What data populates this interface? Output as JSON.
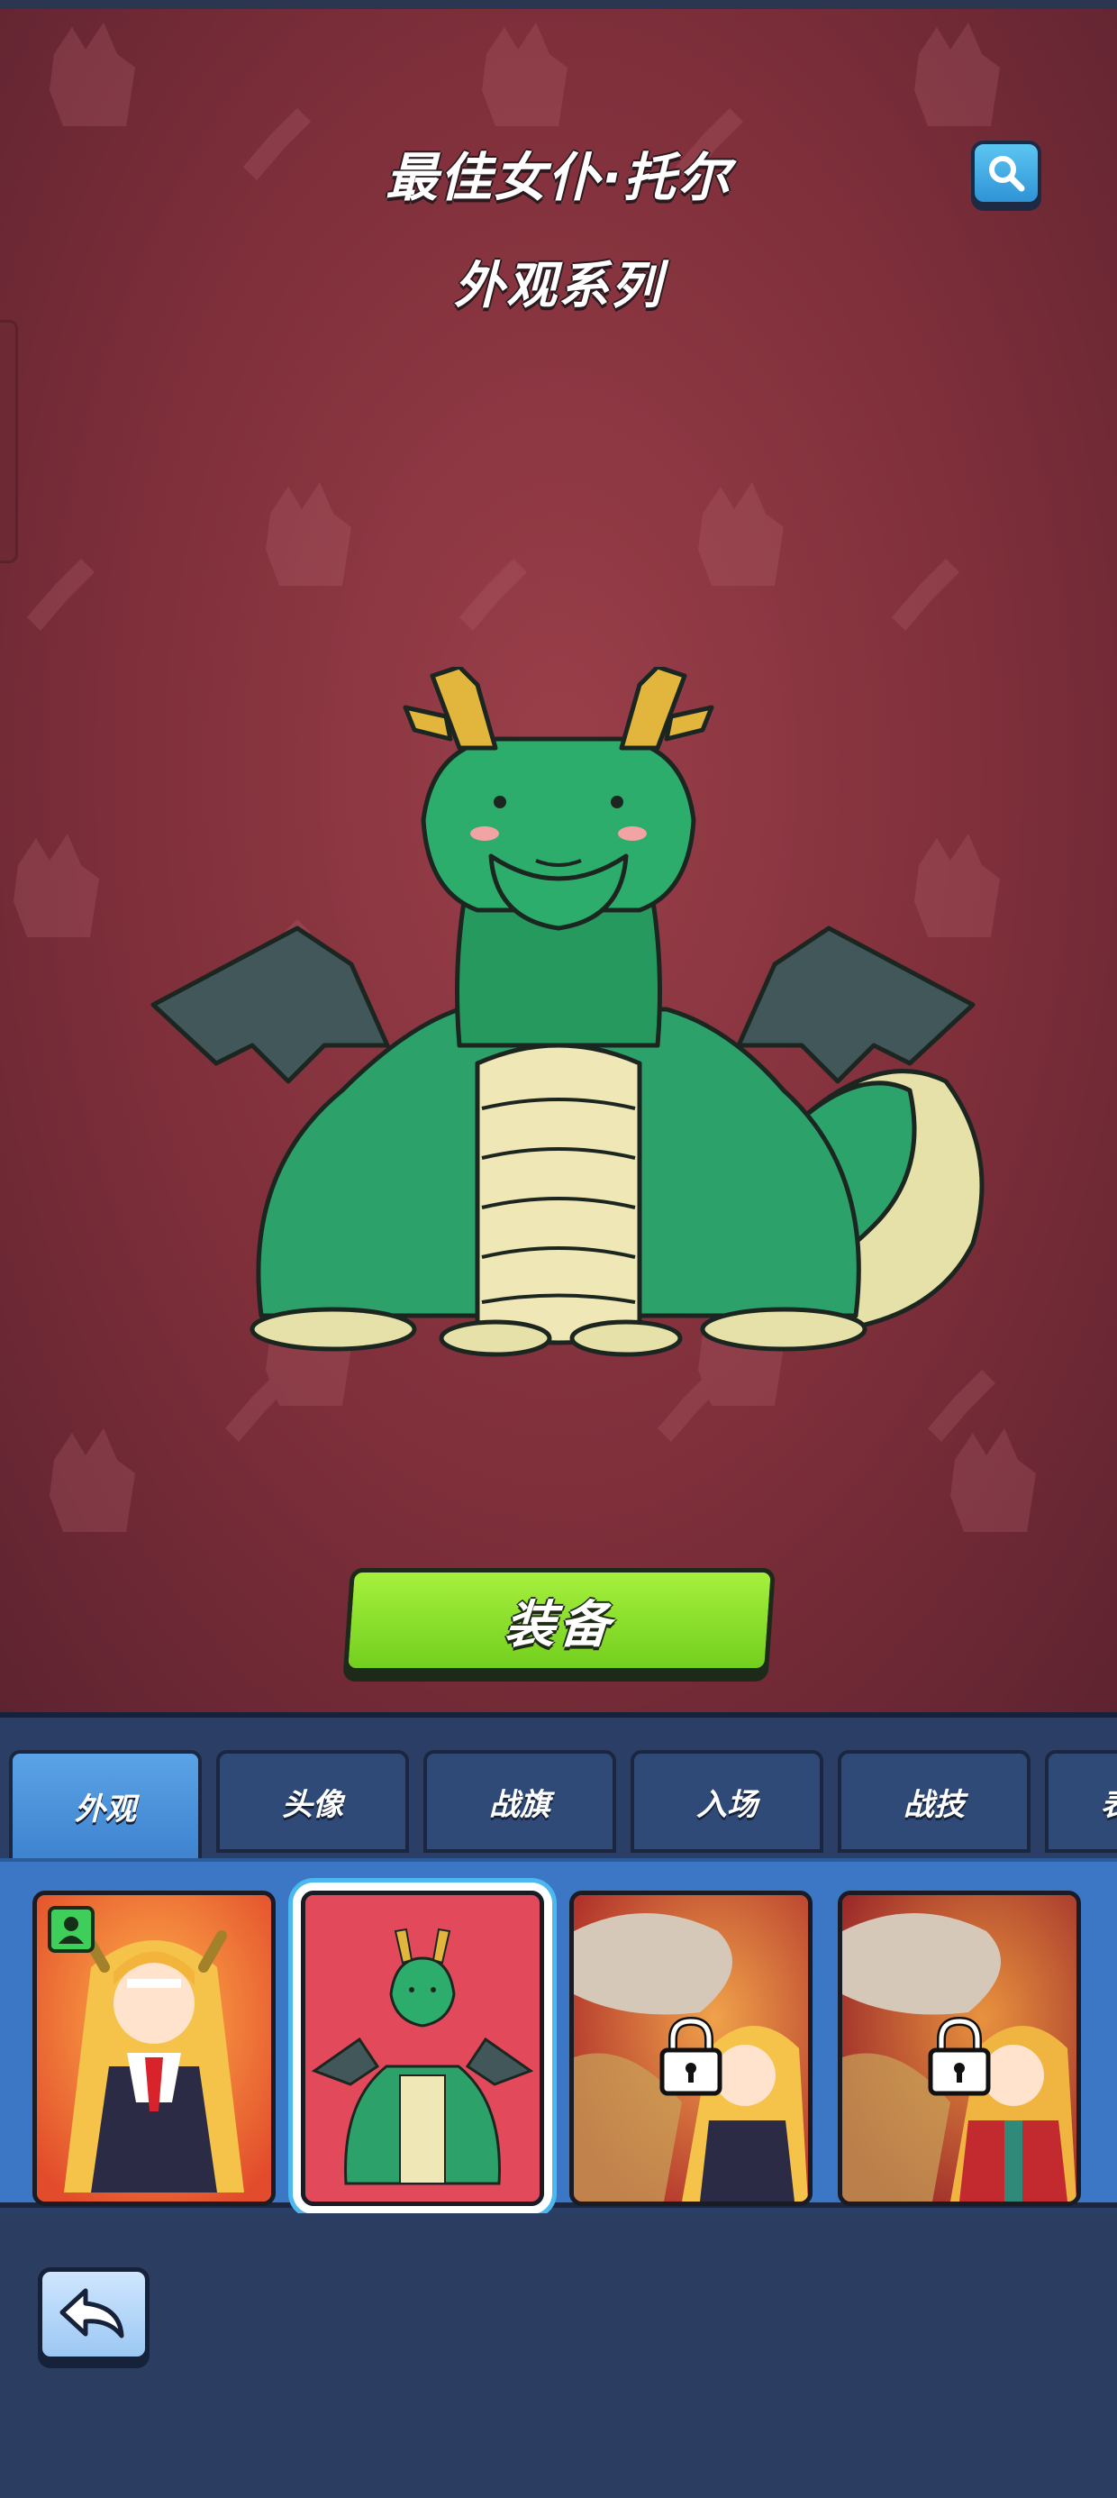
{
  "header": {
    "title": "最佳女仆·托尔",
    "subtitle": "外观系列"
  },
  "search_button": {
    "icon": "search-icon"
  },
  "showcase": {
    "character": "dragon"
  },
  "equip_button": {
    "label": "装备"
  },
  "tabs": [
    {
      "label": "外观",
      "active": true
    },
    {
      "label": "头像",
      "active": false
    },
    {
      "label": "战旗",
      "active": false
    },
    {
      "label": "入场",
      "active": false
    },
    {
      "label": "战技",
      "active": false
    },
    {
      "label": "表",
      "active": false
    }
  ],
  "skins": [
    {
      "name": "maid",
      "locked": false,
      "selected": false,
      "badge": "equipped-icon"
    },
    {
      "name": "dragon",
      "locked": false,
      "selected": true
    },
    {
      "name": "maid-with-dragon",
      "locked": true,
      "selected": false
    },
    {
      "name": "kimono-with-dragon",
      "locked": true,
      "selected": false
    }
  ],
  "back_button": {
    "icon": "back-arrow-icon"
  },
  "colors": {
    "background": "#8a3642",
    "equip_button": "#8be32c",
    "panel": "#2b3f66",
    "active_tab": "#4a90d9",
    "card_strip": "#3b77c4"
  }
}
